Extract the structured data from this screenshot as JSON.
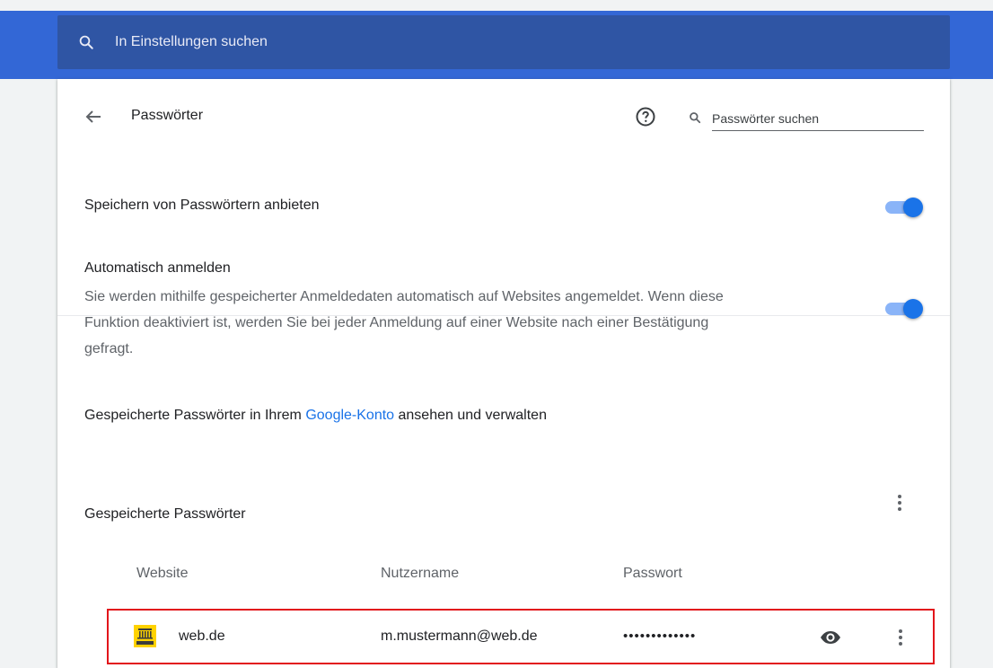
{
  "search": {
    "placeholder": "In Einstellungen suchen",
    "icon": "search-icon"
  },
  "header": {
    "title": "Passwörter",
    "back_icon": "arrow-back-icon",
    "help_icon": "help-circle-icon",
    "password_search_placeholder": "Passwörter suchen"
  },
  "settings": {
    "offer_save_label": "Speichern von Passwörtern anbieten",
    "offer_save_enabled": true,
    "auto_signin_title": "Automatisch anmelden",
    "auto_signin_desc_line1": "Sie werden mithilfe gespeicherter Anmeldedaten automatisch auf Websites angemeldet. Wenn diese",
    "auto_signin_desc_line2": "Funktion deaktiviert ist, werden Sie bei jeder Anmeldung auf einer Website nach einer Bestätigung",
    "auto_signin_desc_line3": "gefragt.",
    "auto_signin_enabled": true
  },
  "google_account": {
    "prefix": "Gespeicherte Passwörter in Ihrem ",
    "link_text": "Google-Konto",
    "suffix": " ansehen und verwalten"
  },
  "saved": {
    "title": "Gespeicherte Passwörter",
    "columns": {
      "website": "Website",
      "username": "Nutzername",
      "password": "Passwort"
    },
    "rows": [
      {
        "website": "web.de",
        "username": "m.mustermann@web.de",
        "password_mask": "•••••••••••••",
        "favicon": "webde-favicon"
      }
    ]
  },
  "colors": {
    "header_blue": "#3367d6",
    "search_box": "#2f55a4",
    "toggle_knob": "#1a73e8",
    "toggle_track": "#8ab4f8",
    "highlight_border": "#e2151b",
    "link": "#1a73e8"
  }
}
